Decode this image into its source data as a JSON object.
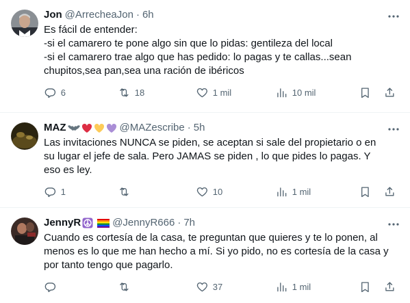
{
  "tweets": [
    {
      "name": "Jon",
      "name_emojis": [],
      "handle": "@ArrecheaJon",
      "dot": "·",
      "time": "6h",
      "text": "Es fácil de entender:\n-si el camarero te pone algo sin que lo pidas: gentileza del local\n-si el camarero trae algo que has pedido: lo pagas y te callas...sean chupitos,sea pan,sea una ración de ibéricos",
      "replies": "6",
      "retweets": "18",
      "likes": "1 mil",
      "views": "10 mil",
      "icons": {
        "more": "more-icon",
        "reply": "reply-icon",
        "retweet": "retweet-icon",
        "like": "heart-icon",
        "views": "views-icon",
        "bookmark": "bookmark-icon",
        "share": "share-icon"
      }
    },
    {
      "name": "MAZ",
      "name_emojis": [
        "bat",
        "red-heart",
        "yellow-heart",
        "purple-heart"
      ],
      "handle": "@MAZescribe",
      "dot": "·",
      "time": "5h",
      "text": "Las invitaciones NUNCA se piden, se aceptan si sale del propietario o en su lugar el jefe de sala. Pero JAMAS se piden , lo que pides lo pagas.  Y eso es ley.",
      "replies": "1",
      "retweets": "",
      "likes": "10",
      "views": "1 mil",
      "icons": {
        "more": "more-icon",
        "reply": "reply-icon",
        "retweet": "retweet-icon",
        "like": "heart-icon",
        "views": "views-icon",
        "bookmark": "bookmark-icon",
        "share": "share-icon"
      }
    },
    {
      "name": "JennyR",
      "name_emojis": [
        "peace-symbol",
        "rainbow-flag"
      ],
      "handle": "@JennyR666",
      "dot": "·",
      "time": "7h",
      "text": "Cuando es cortesía de la casa, te preguntan que quieres y te lo ponen, al menos es lo que me han hecho a mí. Si yo pido, no es cortesía de la casa y por tanto tengo que pagarlo.",
      "replies": "",
      "retweets": "",
      "likes": "37",
      "views": "1 mil",
      "icons": {
        "more": "more-icon",
        "reply": "reply-icon",
        "retweet": "retweet-icon",
        "like": "heart-icon",
        "views": "views-icon",
        "bookmark": "bookmark-icon",
        "share": "share-icon"
      }
    }
  ],
  "colors": {
    "text_primary": "#0f1419",
    "text_secondary": "#536471",
    "divider": "#eff3f4",
    "heart_red": "#e0245e",
    "heart_yellow": "#ffcc4d",
    "heart_purple": "#aa8ed6",
    "peace_purple": "#9266cc"
  }
}
